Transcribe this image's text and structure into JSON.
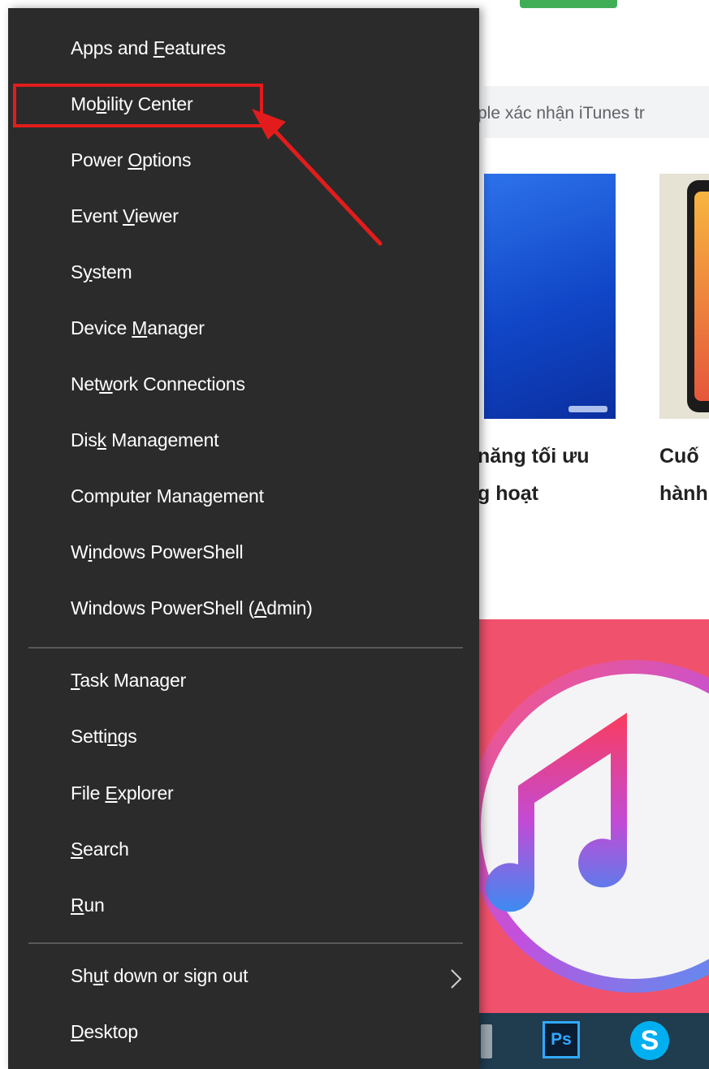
{
  "background": {
    "search_bar_text": "ple xác nhận iTunes tr",
    "card1_title_line1": "năng tối ưu",
    "card1_title_line2": "g hoạt",
    "card2_title_line1": "Cuố",
    "card2_title_line2": "hành",
    "taskbar": {
      "ps_label": "Ps",
      "skype_label": "S"
    }
  },
  "menu": {
    "items_group1": [
      {
        "label": "Apps and Features",
        "underline": "F",
        "name": "menu-item-apps-and-features"
      },
      {
        "label": "Mobility Center",
        "underline": "b",
        "name": "menu-item-mobility-center"
      },
      {
        "label": "Power Options",
        "underline": "O",
        "name": "menu-item-power-options"
      },
      {
        "label": "Event Viewer",
        "underline": "V",
        "name": "menu-item-event-viewer"
      },
      {
        "label": "System",
        "underline": "y",
        "name": "menu-item-system"
      },
      {
        "label": "Device Manager",
        "underline": "M",
        "name": "menu-item-device-manager"
      },
      {
        "label": "Network Connections",
        "underline": "w",
        "name": "menu-item-network-connections"
      },
      {
        "label": "Disk Management",
        "underline": "k",
        "name": "menu-item-disk-management"
      },
      {
        "label": "Computer Management",
        "underline": "g",
        "name": "menu-item-computer-management"
      },
      {
        "label": "Windows PowerShell",
        "underline": "i",
        "name": "menu-item-windows-powershell"
      },
      {
        "label": "Windows PowerShell (Admin)",
        "underline": "A",
        "name": "menu-item-windows-powershell-admin"
      }
    ],
    "items_group2": [
      {
        "label": "Task Manager",
        "underline": "T",
        "name": "menu-item-task-manager"
      },
      {
        "label": "Settings",
        "underline": "n",
        "name": "menu-item-settings"
      },
      {
        "label": "File Explorer",
        "underline": "E",
        "name": "menu-item-file-explorer"
      },
      {
        "label": "Search",
        "underline": "S",
        "name": "menu-item-search"
      },
      {
        "label": "Run",
        "underline": "R",
        "name": "menu-item-run"
      }
    ],
    "items_group3": [
      {
        "label": "Shut down or sign out",
        "underline": "u",
        "name": "menu-item-shut-down-or-sign-out",
        "submenu": true
      },
      {
        "label": "Desktop",
        "underline": "D",
        "name": "menu-item-desktop"
      }
    ],
    "highlighted_item": "Mobility Center"
  },
  "colors": {
    "menu_background": "#2b2b2b",
    "menu_text": "#ffffff",
    "highlight_annotation": "#e21c1c",
    "hero_background": "#f0516c"
  },
  "icons": {
    "submenu_arrow": "chevron-right-icon",
    "annotation_arrow": "red-arrow-icon",
    "itunes_logo": "itunes-logo-icon"
  }
}
